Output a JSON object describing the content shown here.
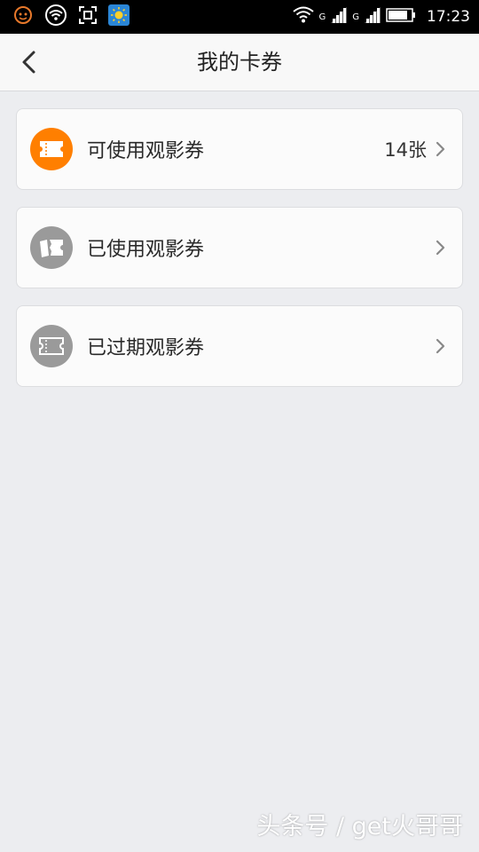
{
  "status_bar": {
    "time": "17:23",
    "network_1": "G",
    "network_2": "G",
    "left_icons": [
      "face-icon",
      "wifi-signal-icon",
      "scan-icon",
      "weather-icon"
    ],
    "right_icons": [
      "wifi-icon",
      "signal-icon",
      "signal-icon",
      "battery-icon"
    ]
  },
  "nav": {
    "title": "我的卡券",
    "back_icon": "chevron-left-icon"
  },
  "cards": [
    {
      "label": "可使用观影券",
      "count": "14张",
      "icon": "ticket-icon",
      "icon_color": "#ff7f00"
    },
    {
      "label": "已使用观影券",
      "count": "",
      "icon": "torn-ticket-icon",
      "icon_color": "#9a9a9a"
    },
    {
      "label": "已过期观影券",
      "count": "",
      "icon": "ticket-icon",
      "icon_color": "#9a9a9a"
    }
  ],
  "watermark": "头条号 / get火哥哥"
}
